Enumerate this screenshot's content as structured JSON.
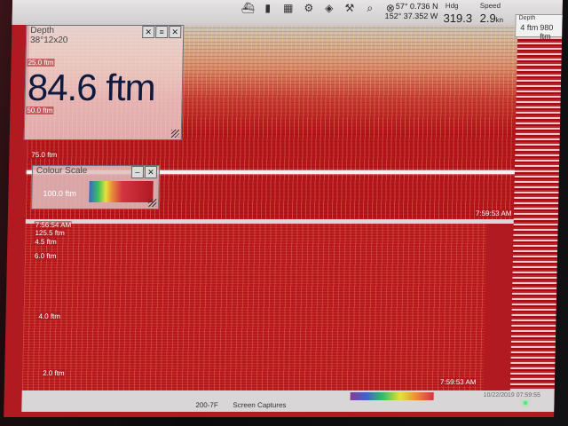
{
  "top_bar": {
    "lat": "57° 0.736",
    "lat_suffix": "N",
    "lon": "152° 37.352",
    "lon_suffix": "W",
    "hdg_label": "Hdg",
    "hdg_value": "319.3",
    "spd_label": "Speed",
    "spd_value": "2.9",
    "spd_unit": "kn",
    "depth_label": "Depth",
    "depth_mini_1": "4 ftm",
    "depth_mini_2": "980 ftm"
  },
  "depth_panel": {
    "title": "Depth",
    "subtitle": "38°12x20",
    "value": "84.6 ftm"
  },
  "colour_scale": {
    "title": "Colour Scale",
    "label": "100.0 ftm"
  },
  "depth_ticks": {
    "t25": "25.0 ftm",
    "t50": "50.0 ftm",
    "t75": "75.0 ftm",
    "t100": "100.0 ftm",
    "t125": "125.5 ftm",
    "t5": "4.5 ftm",
    "t6": "6.0 ftm",
    "t4": "4.0 ftm",
    "t2": "2.0 ftm"
  },
  "times": {
    "t1": "7:56:54 AM",
    "t2": "7:59:53 AM",
    "t3": "7:59:53 AM"
  },
  "status_bar": {
    "left": "200-7F",
    "center": "Screen Captures",
    "right": "10/22/2019 07:59:55"
  }
}
